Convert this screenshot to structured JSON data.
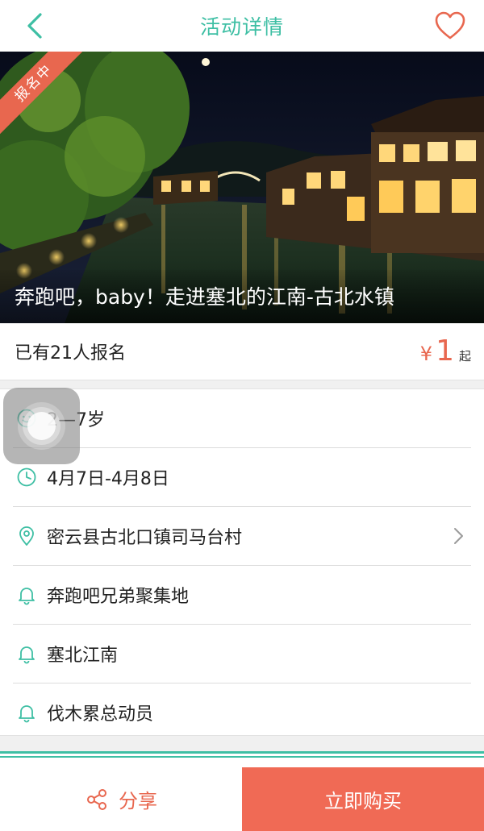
{
  "header": {
    "title": "活动详情",
    "back_icon": "chevron-left-icon",
    "favorite_icon": "heart-icon"
  },
  "colors": {
    "accent": "#3ebfa4",
    "price": "#e8674f",
    "buy_button": "#f06a55"
  },
  "hero": {
    "badge": "报名中",
    "title": "奔跑吧，baby！走进塞北的江南-古北水镇"
  },
  "signup": {
    "count_text": "已有21人报名",
    "price_currency": "¥",
    "price_value": "1",
    "price_suffix": "起"
  },
  "info": {
    "age": {
      "icon": "smiley-icon",
      "text": "2—7岁"
    },
    "date": {
      "icon": "clock-icon",
      "text": "4月7日-4月8日"
    },
    "location": {
      "icon": "location-pin-icon",
      "text": "密云县古北口镇司马台村"
    },
    "tags": [
      {
        "icon": "bell-icon",
        "text": "奔跑吧兄弟聚集地"
      },
      {
        "icon": "bell-icon",
        "text": "塞北江南"
      },
      {
        "icon": "bell-icon",
        "text": "伐木累总动员"
      }
    ]
  },
  "footer": {
    "share_label": "分享",
    "share_icon": "share-icon",
    "buy_label": "立即购买"
  }
}
